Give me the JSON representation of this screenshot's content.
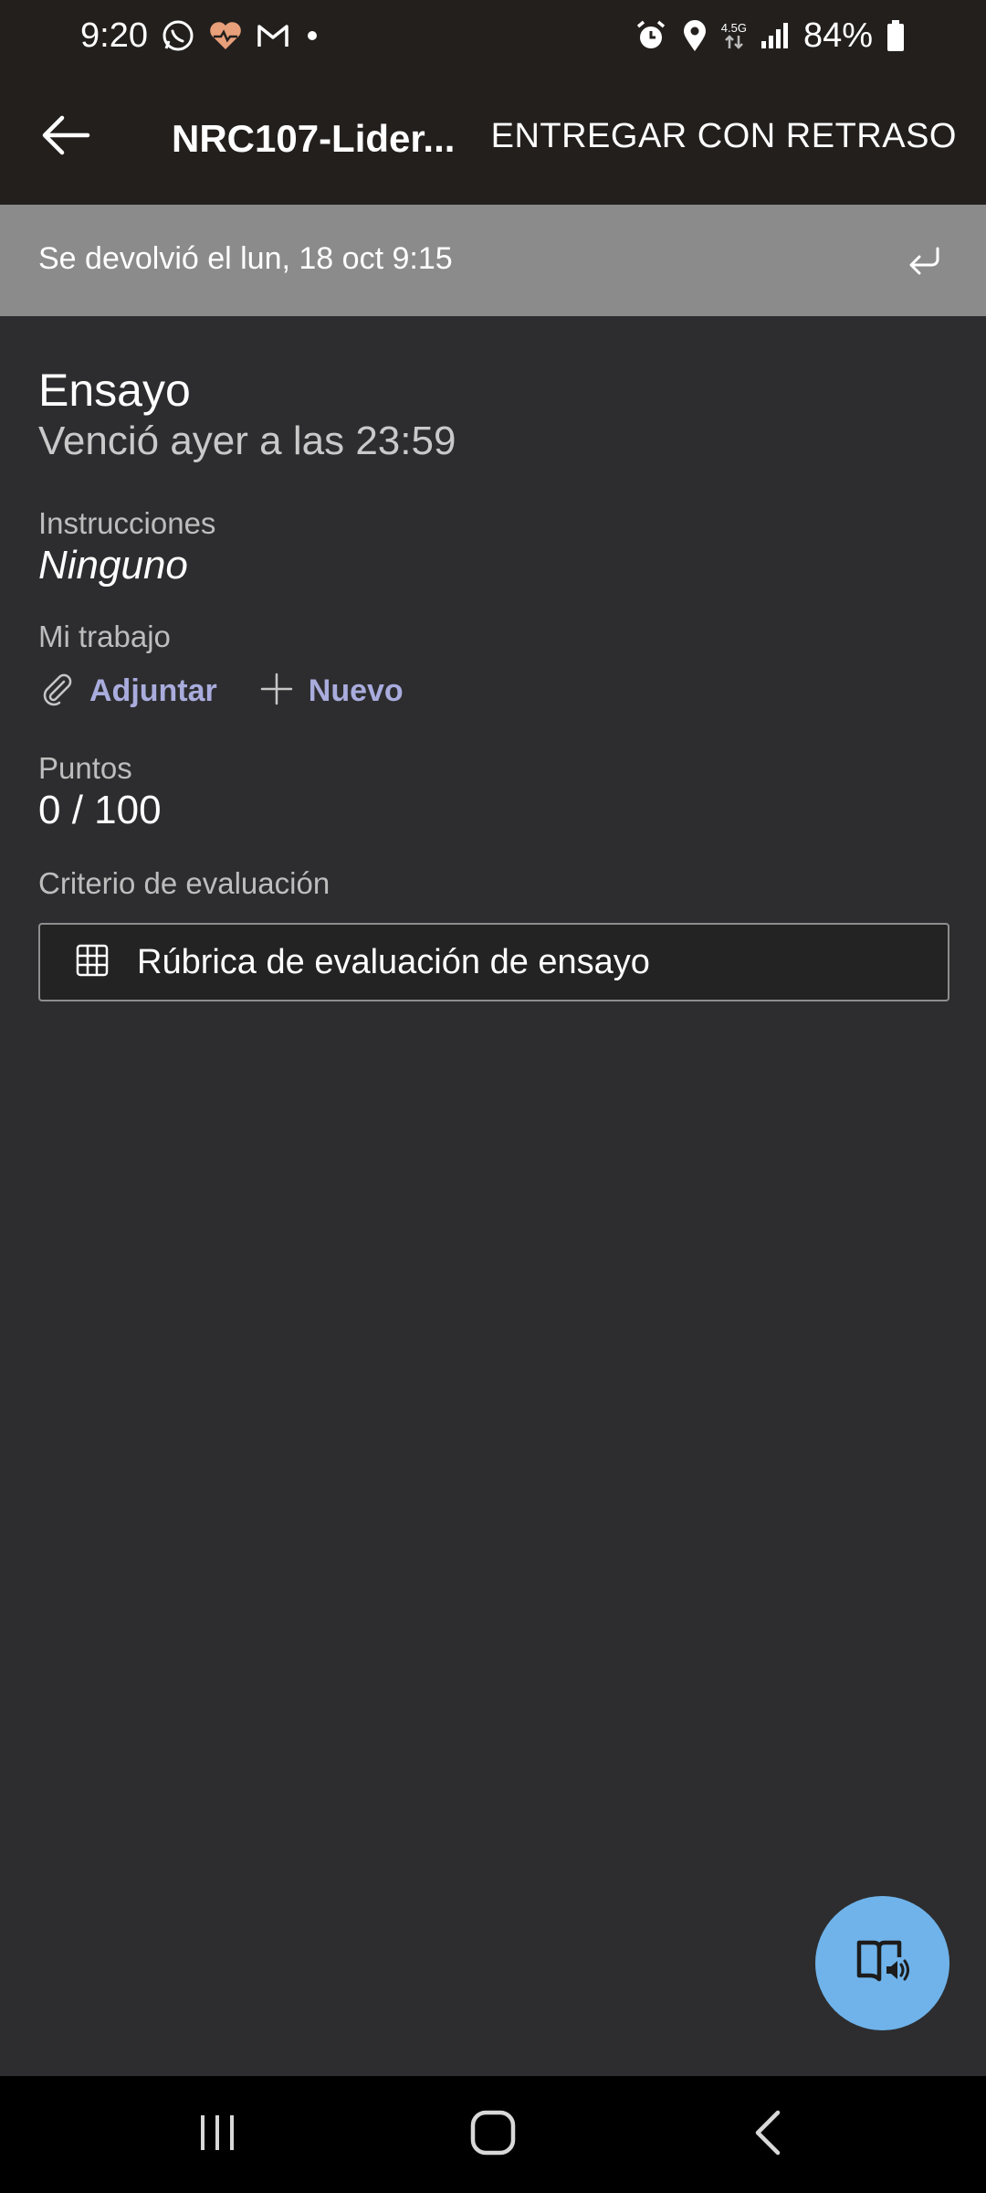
{
  "status_bar": {
    "time": "9:20",
    "network": "4.5G",
    "battery": "84%",
    "icons_left": [
      "whatsapp-icon",
      "health-icon",
      "gmail-icon",
      "dot-icon"
    ],
    "icons_right": [
      "alarm-icon",
      "location-icon",
      "network-icon",
      "signal-icon",
      "battery-icon"
    ]
  },
  "app_bar": {
    "title": "NRC107-Lider...",
    "action": "ENTREGAR CON RETRASO"
  },
  "banner": {
    "text": "Se devolvió el lun, 18 oct 9:15"
  },
  "assignment": {
    "title": "Ensayo",
    "due": "Venció ayer a las 23:59",
    "instructions_label": "Instrucciones",
    "instructions_value": "Ninguno",
    "work_label": "Mi trabajo",
    "attach_label": "Adjuntar",
    "new_label": "Nuevo",
    "points_label": "Puntos",
    "points_value": "0 / 100",
    "criteria_label": "Criterio de evaluación",
    "rubric_label": "Rúbrica de evaluación de ensayo"
  },
  "colors": {
    "accent": "#a9acdd",
    "fab": "#6fb3ea",
    "background": "#2d2d2f",
    "bar": "#231f1d",
    "banner": "#8b8b8b"
  }
}
